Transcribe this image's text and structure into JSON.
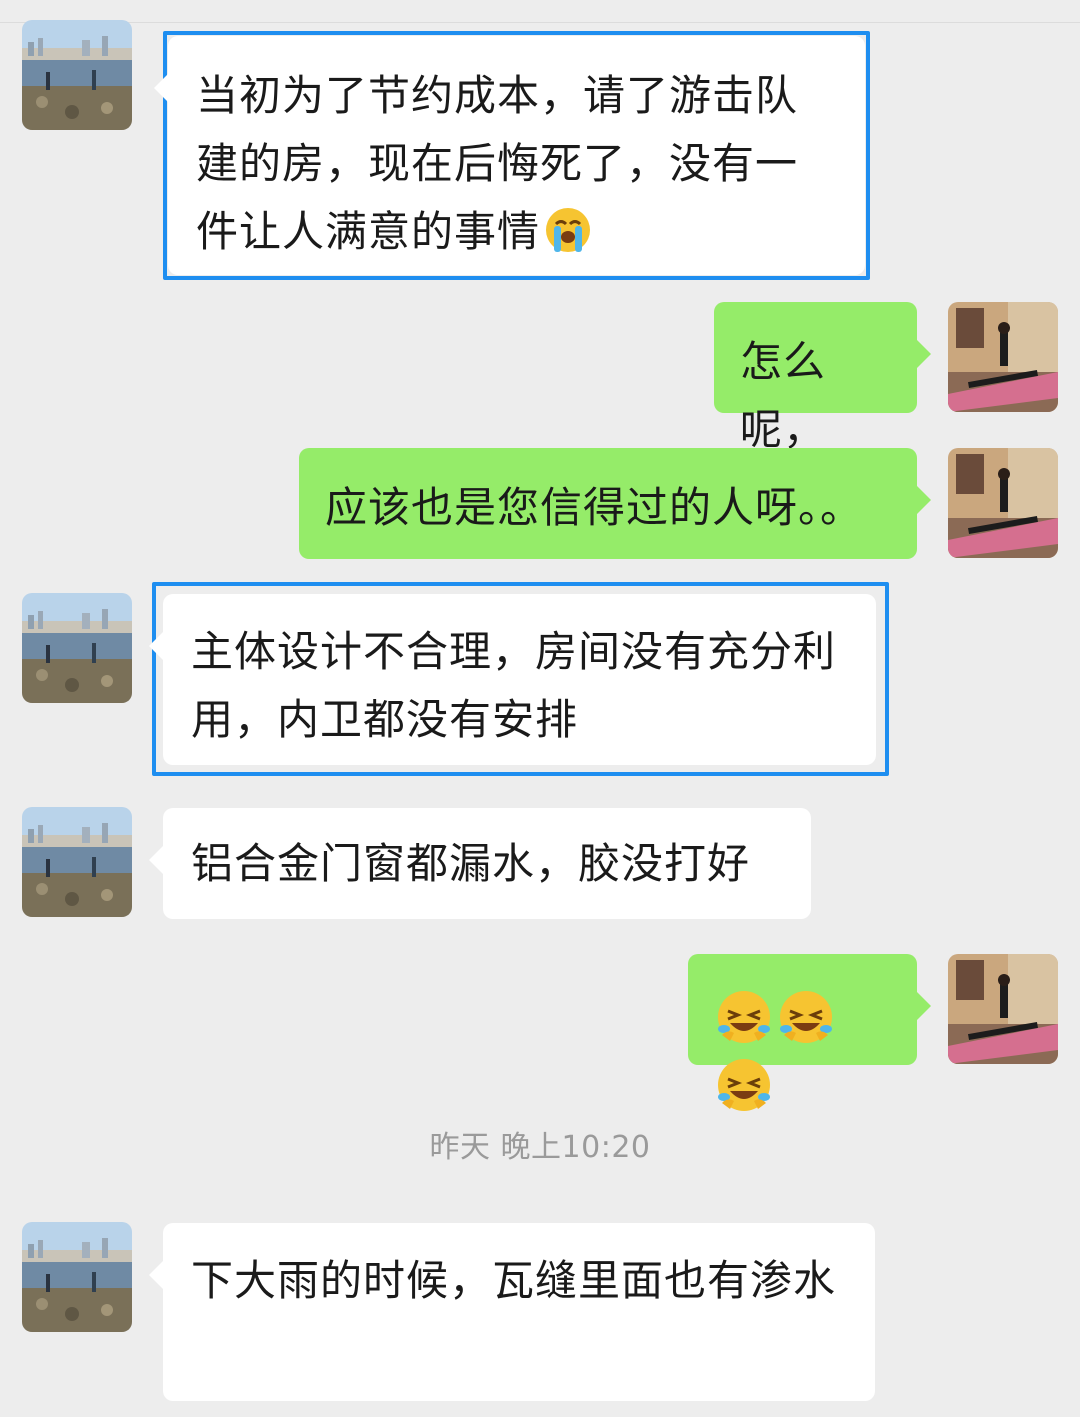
{
  "messages": [
    {
      "side": "in",
      "text": "当初为了节约成本，请了游击队建的房，现在后悔死了，没有一件让人满意的事情",
      "emoji": "loudly-crying"
    },
    {
      "side": "out",
      "text": "怎么呢，"
    },
    {
      "side": "out",
      "text": "应该也是您信得过的人呀。。"
    },
    {
      "side": "in",
      "text": "主体设计不合理，房间没有充分利用，内卫都没有安排"
    },
    {
      "side": "in",
      "text": "铝合金门窗都漏水，胶没打好"
    },
    {
      "side": "out",
      "emoji": "rolling-laughing x3"
    },
    {
      "side": "in",
      "text": "下大雨的时候，瓦缝里面也有渗水"
    }
  ],
  "timestamp": "昨天 晚上10:20",
  "colors": {
    "background": "#ededed",
    "incoming_bubble": "#ffffff",
    "outgoing_bubble": "#95ec69",
    "highlight_border": "#1e8ef0",
    "timestamp_text": "#9a9a9a"
  }
}
